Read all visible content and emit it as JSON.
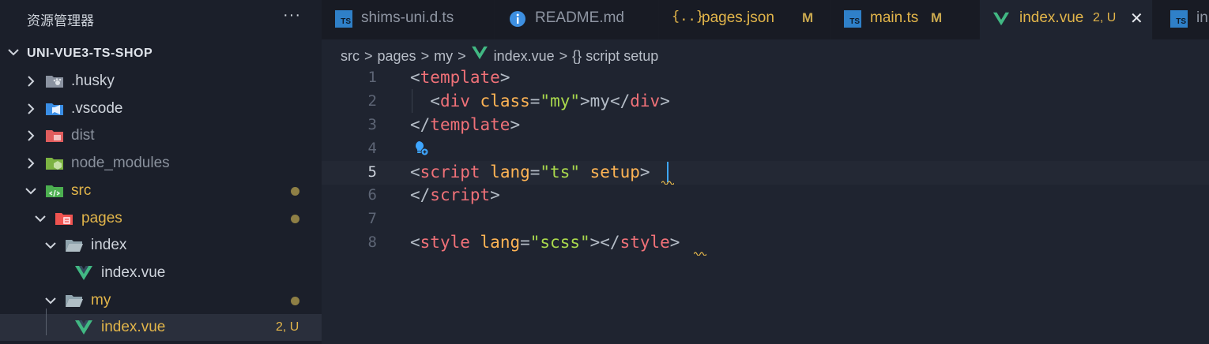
{
  "sidebar": {
    "title": "资源管理器",
    "more": "···",
    "project": "UNI-VUE3-TS-SHOP",
    "items": [
      {
        "label": ".husky",
        "status": ""
      },
      {
        "label": ".vscode",
        "status": ""
      },
      {
        "label": "dist",
        "status": ""
      },
      {
        "label": "node_modules",
        "status": ""
      },
      {
        "label": "src",
        "status": "dot"
      },
      {
        "label": "pages",
        "status": "dot"
      },
      {
        "label": "index",
        "status": ""
      },
      {
        "label": "index.vue",
        "status": ""
      },
      {
        "label": "my",
        "status": "dot"
      },
      {
        "label": "index.vue",
        "status": "2, U"
      }
    ]
  },
  "tabs": [
    {
      "label": "shims-uni.d.ts",
      "icon": "ts-icon",
      "status": ""
    },
    {
      "label": "README.md",
      "icon": "info-icon",
      "status": ""
    },
    {
      "label": "pages.json",
      "icon": "json-braces-icon",
      "status": "M"
    },
    {
      "label": "main.ts",
      "icon": "ts-icon",
      "status": "M"
    },
    {
      "label": "index.vue",
      "icon": "vue-icon",
      "status": "2, U",
      "close": "✕"
    },
    {
      "label": "in",
      "icon": "ts-icon",
      "status": ""
    }
  ],
  "ts_icon_text": "TS",
  "json_icon_text": "{..}",
  "breadcrumbs": [
    "src",
    "pages",
    "my",
    "index.vue",
    "{} script setup"
  ],
  "breadcrumb_sep": ">",
  "line_numbers": [
    "1",
    "2",
    "3",
    "4",
    "5",
    "6",
    "7",
    "8"
  ],
  "code": {
    "l1": {
      "lt": "<",
      "tag": "template",
      "gt": ">"
    },
    "l2": {
      "indent": "  ",
      "lt": "<",
      "tag": "div",
      "sp": " ",
      "attr": "class",
      "eq": "=",
      "str": "\"my\"",
      "gt": ">",
      "text": "my",
      "lt2": "</",
      "tag2": "div",
      "gt2": ">"
    },
    "l3": {
      "lt": "</",
      "tag": "template",
      "gt": ">"
    },
    "l5": {
      "lt": "<",
      "tag": "script",
      "sp": " ",
      "attr": "lang",
      "eq": "=",
      "str": "\"ts\"",
      "sp2": " ",
      "attr2": "setup",
      "gt": ">"
    },
    "l6": {
      "lt": "</",
      "tag": "script",
      "gt": ">"
    },
    "l8": {
      "lt": "<",
      "tag": "style",
      "sp": " ",
      "attr": "lang",
      "eq": "=",
      "str": "\"scss\"",
      "gt": ">",
      "lt2": "</",
      "tag2": "style",
      "gt2": ">"
    }
  },
  "colors": {
    "tag": "#f07178",
    "attribute": "#ffb454",
    "string": "#aad94c",
    "modified": "#c9a84f",
    "untracked": "#e2b54a",
    "vue_green": "#41b883",
    "caret": "#3ea6ff"
  }
}
